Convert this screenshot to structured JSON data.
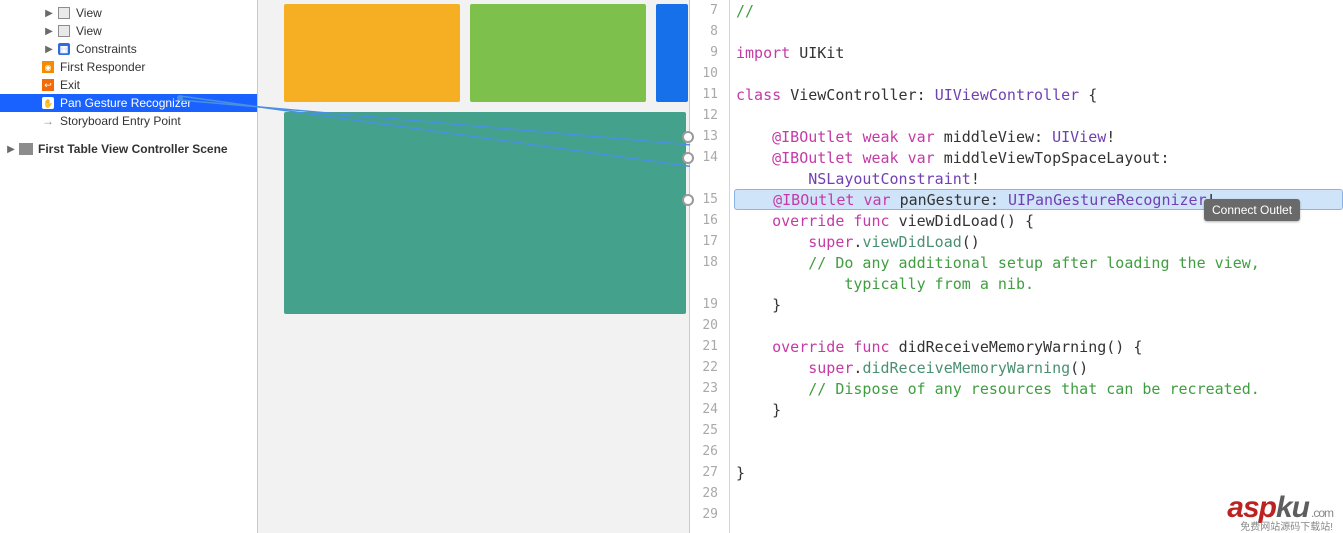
{
  "outline": {
    "rows": [
      {
        "indent": "ind-1",
        "disclosure": "▶",
        "icon": "viewbox",
        "label": "View"
      },
      {
        "indent": "ind-1",
        "disclosure": "▶",
        "icon": "viewbox",
        "label": "View"
      },
      {
        "indent": "ind-1",
        "disclosure": "▶",
        "icon": "constraints",
        "label": "Constraints"
      },
      {
        "indent": "ind-2",
        "disclosure": "",
        "icon": "firstresp",
        "label": "First Responder"
      },
      {
        "indent": "ind-2",
        "disclosure": "",
        "icon": "exit",
        "label": "Exit"
      },
      {
        "indent": "ind-2",
        "disclosure": "",
        "icon": "gesture",
        "label": "Pan Gesture Recognizer",
        "selected": true
      },
      {
        "indent": "ind-2",
        "disclosure": "",
        "icon": "arrow",
        "label": "Storyboard Entry Point"
      }
    ],
    "scene_label": "First Table View Controller Scene"
  },
  "editor": {
    "first_line_no": 7,
    "breakpoints": [
      13,
      14,
      15
    ],
    "highlight_line": 15,
    "tooltip": "Connect Outlet",
    "tokens": {
      "import": "import",
      "class": "class",
      "override": "override",
      "func": "func",
      "weak": "weak",
      "var": "var",
      "super": "super",
      "iboutlet": "@IBOutlet",
      "uikit": "UIKit",
      "vc": "ViewController",
      "uivc": "UIViewController",
      "mv": "middleView",
      "uiview": "UIView",
      "mvtsl": "middleViewTopSpaceLayout",
      "nslc": "NSLayoutConstraint",
      "pg": "panGesture",
      "uipgr": "UIPanGestureRecognizer",
      "vdl": "viewDidLoad",
      "drmw": "didReceiveMemoryWarning",
      "cmt1": "// Do any additional setup after loading the view,",
      "cmt1b": "typically from a nib.",
      "cmt2": "// Dispose of any resources that can be recreated.",
      "slashslash": "//"
    }
  },
  "watermark": {
    "asp": "asp",
    "ku": "ku",
    "dom": ".com",
    "cn": "免费网站源码下载站!"
  }
}
